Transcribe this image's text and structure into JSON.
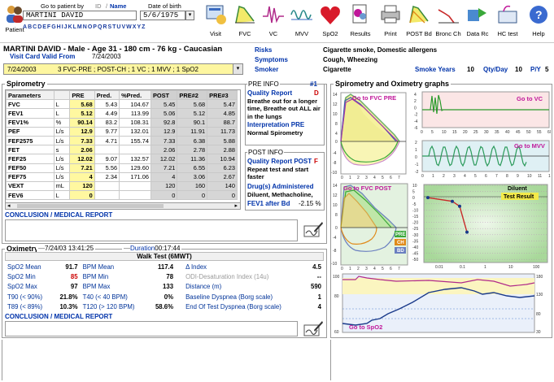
{
  "toolbar": {
    "patient_label": "Patient",
    "goto_label": "Go to patient by",
    "id_label": "ID",
    "name_label": "Name",
    "dob_label": "Date of birth",
    "patient_name_value": "MARTINI DAVID",
    "dob_value": "5/6/1975",
    "alphabet": [
      "A",
      "B",
      "C",
      "D",
      "E",
      "F",
      "G",
      "H",
      "I",
      "J",
      "K",
      "L",
      "M",
      "N",
      "O",
      "P",
      "Q",
      "R",
      "S",
      "T",
      "U",
      "V",
      "W",
      "X",
      "Y",
      "Z"
    ],
    "buttons": [
      {
        "label": "Visit",
        "icon": "visit-icon"
      },
      {
        "label": "FVC",
        "icon": "fvc-icon"
      },
      {
        "label": "VC",
        "icon": "vc-icon"
      },
      {
        "label": "MVV",
        "icon": "mvv-icon"
      },
      {
        "label": "SpO2",
        "icon": "spo2-heart-icon"
      },
      {
        "label": "Results",
        "icon": "results-icon"
      },
      {
        "label": "Print",
        "icon": "printer-icon"
      },
      {
        "label": "POST Bd",
        "icon": "post-bd-icon"
      },
      {
        "label": "Bronc Ch",
        "icon": "bronc-ch-icon"
      },
      {
        "label": "Data Rc",
        "icon": "data-rc-icon"
      },
      {
        "label": "HC test",
        "icon": "hc-test-icon"
      },
      {
        "label": "Help",
        "icon": "help-icon"
      }
    ]
  },
  "header": {
    "patient_line": "MARTINI DAVID - Male - Age 31 - 180 cm - 76 kg - Caucasian",
    "visit_card_label": "Visit Card Valid From",
    "visit_card_date": "7/24/2003",
    "visit_select_date": "7/24/2003",
    "visit_select_tests": "3 FVC-PRE ; POST-CH ; 1 VC ; 1 MVV ; 1 SpO2",
    "risks_label": "Risks",
    "risks_value": "Cigarette smoke, Domestic allergens",
    "symptoms_label": "Symptoms",
    "symptoms_value": "Cough, Wheezing",
    "smoker_label": "Smoker",
    "smoker_value": "Cigarette",
    "smoke_years_label": "Smoke Years",
    "smoke_years_value": "10",
    "qty_day_label": "Qty/Day",
    "qty_day_value": "10",
    "py_label": "P/Y",
    "py_value": "5"
  },
  "spirometry": {
    "title": "Spirometry",
    "columns": [
      "Parameters",
      "",
      "PRE",
      "Pred.",
      "%Pred.",
      "POST",
      "PRE#2",
      "PRE#3"
    ],
    "rows": [
      [
        "FVC",
        "L",
        "5.68",
        "5.43",
        "104.67",
        "5.45",
        "5.68",
        "5.47"
      ],
      [
        "FEV1",
        "L",
        "5.12",
        "4.49",
        "113.99",
        "5.06",
        "5.12",
        "4.85"
      ],
      [
        "FEV1%",
        "%",
        "90.14",
        "83.2",
        "108.31",
        "92.8",
        "90.1",
        "88.7"
      ],
      [
        "PEF",
        "L/s",
        "12.9",
        "9.77",
        "132.01",
        "12.9",
        "11.91",
        "11.73"
      ],
      [
        "FEF2575",
        "L/s",
        "7.33",
        "4.71",
        "155.74",
        "7.33",
        "6.38",
        "5.88"
      ],
      [
        "FET",
        "s",
        "2.06",
        "",
        "",
        "2.06",
        "2.78",
        "2.88"
      ],
      [
        "FEF25",
        "L/s",
        "12.02",
        "9.07",
        "132.57",
        "12.02",
        "11.36",
        "10.94"
      ],
      [
        "FEF50",
        "L/s",
        "7.21",
        "5.56",
        "129.60",
        "7.21",
        "6.55",
        "6.23"
      ],
      [
        "FEF75",
        "L/s",
        "4",
        "2.34",
        "171.06",
        "4",
        "3.06",
        "2.67"
      ],
      [
        "VEXT",
        "mL",
        "120",
        "",
        "",
        "120",
        "160",
        "140"
      ],
      [
        "FEV6",
        "L",
        "0",
        "",
        "",
        "0",
        "0",
        "0"
      ]
    ],
    "conclusion_label": "CONCLUSION / MEDICAL REPORT"
  },
  "pre_info": {
    "title": "PRE INFO",
    "num": "#1",
    "quality_label": "Quality Report",
    "quality_grade": "D",
    "quality_text": "Breathe out for a longer time, Breathe out ALL air in the lungs",
    "interp_label": "Interpretation PRE",
    "interp_value": "Normal Spirometry"
  },
  "post_info": {
    "title": "POST INFO",
    "quality_label": "Quality Report POST",
    "quality_grade": "F",
    "quality_text": "Repeat test and start faster",
    "drugs_label": "Drug(s) Administered",
    "drugs_value": "Diluent, Methacholine,",
    "fev1_label": "FEV1 after Bd",
    "fev1_value": "-2.15 %"
  },
  "oximetry": {
    "title": "Oximetry",
    "datetime": "7/24/03 13:41:25",
    "duration_label": "Duration",
    "duration_value": "00:17:44",
    "test_name": "Walk Test (6MWT)",
    "rows": [
      [
        "SpO2 Mean",
        "91.7",
        "BPM Mean",
        "117.4",
        "Δ Index",
        "4.5"
      ],
      [
        "SpO2 Min",
        "85",
        "BPM Min",
        "78",
        "ODI-Desaturation Index (14u)",
        "--"
      ],
      [
        "SpO2 Max",
        "97",
        "BPM Max",
        "133",
        "Distance (m)",
        "590"
      ],
      [
        "T90 (< 90%)",
        "21.8%",
        "T40 (< 40 BPM)",
        "0%",
        "Baseline Dyspnea (Borg scale)",
        "1"
      ],
      [
        "T89 (< 89%)",
        "10.3%",
        "T120 (> 120 BPM)",
        "58.6%",
        "End Of Test Dyspnea (Borg scale)",
        "4"
      ]
    ],
    "conclusion_label": "CONCLUSION / MEDICAL REPORT"
  },
  "graphs": {
    "title": "Spirometry and Oximetry graphs",
    "fvc_pre_label": "Go to FVC PRE",
    "vc_label": "Go to VC",
    "mvv_label": "Go to MVV",
    "fvc_post_label": "Go to FVC POST",
    "spo2_label": "Go to SpO2",
    "diluent_label": "Diluent",
    "test_result_label": "Test Result",
    "legend_pre": "PRE",
    "legend_ch": "CH",
    "legend_bd": "BD",
    "colors": {
      "accent_blue": "#0033aa",
      "pre": "#3aa83a",
      "ch": "#e08a1a",
      "bd": "#6a7fc0",
      "magenta": "#c0179a"
    }
  },
  "chart_data": [
    {
      "type": "line",
      "title": "Go to VC",
      "x_ticks": [
        "0",
        "5",
        "10",
        "15",
        "20",
        "25",
        "30",
        "35",
        "40",
        "45",
        "50",
        "55",
        "60"
      ],
      "y_ticks": [
        "4",
        "2",
        "0",
        "-2",
        "-4",
        "-6"
      ],
      "xlim": [
        0,
        60
      ],
      "ylim": [
        -6,
        4
      ]
    },
    {
      "type": "line",
      "title": "Go to MVV",
      "x_ticks": [
        "0",
        "1",
        "2",
        "3",
        "4",
        "5",
        "6",
        "7",
        "8",
        "9",
        "10",
        "11",
        "12"
      ],
      "y_ticks": [
        "2",
        "1",
        "0",
        "-1",
        "-2"
      ],
      "xlim": [
        0,
        12
      ],
      "ylim": [
        -2,
        2
      ]
    },
    {
      "type": "line",
      "title": "Go to SpO2",
      "y_left_ticks": [
        "100",
        "80",
        "60"
      ],
      "y_right_ticks": [
        "180",
        "130",
        "80",
        "30"
      ]
    },
    {
      "type": "line",
      "title": "Test Result",
      "x_ticks": [
        "0.01",
        "0.1",
        "1",
        "10",
        "100"
      ],
      "y_ticks": [
        "10",
        "5",
        "0",
        "-5",
        "-10",
        "-15",
        "-20",
        "-25",
        "-30",
        "-35",
        "-40",
        "-45",
        "-50"
      ],
      "x": [
        0.005,
        0.05,
        0.1,
        0.2
      ],
      "y": [
        0,
        -3,
        -7,
        -28
      ]
    }
  ]
}
